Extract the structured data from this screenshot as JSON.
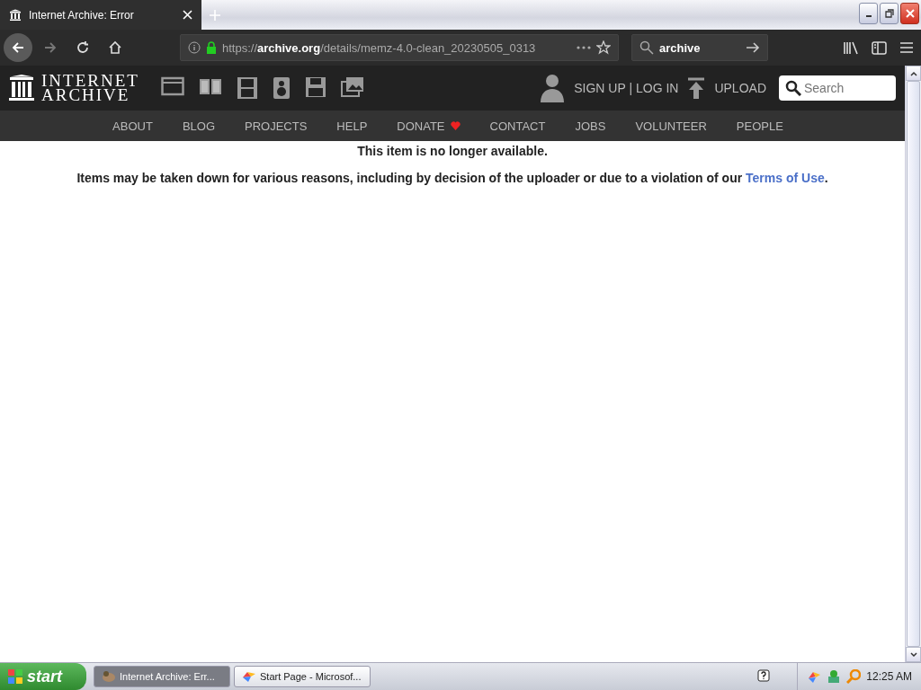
{
  "browser": {
    "tabs": [
      {
        "title": "Internet Archive: Error",
        "selected": true
      }
    ],
    "url": "https://**archive.org**/details/memz-4.0-clean_20230505_0313",
    "search": {
      "value": "archive"
    }
  },
  "site": {
    "logo": [
      "INTERNET",
      "ARCHIVE"
    ],
    "account": "SIGN UP | LOG IN",
    "upload": "UPLOAD",
    "search": {
      "placeholder": "Search"
    },
    "nav": [
      {
        "label": "ABOUT"
      },
      {
        "label": "BLOG"
      },
      {
        "label": "PROJECTS"
      },
      {
        "label": "HELP"
      },
      {
        "label": "DONATE",
        "heart": true
      },
      {
        "label": "CONTACT"
      },
      {
        "label": "JOBS"
      },
      {
        "label": "VOLUNTEER"
      },
      {
        "label": "PEOPLE"
      }
    ]
  },
  "message": {
    "heading": "This item is no longer available.",
    "text": "Items may be taken down for various reasons, including by decision of the uploader or due to a violation of our",
    "link": "Terms of Use",
    "end": "."
  },
  "taskbar": {
    "start": "start",
    "items": [
      {
        "label": "Internet Archive: Err...",
        "selected": true,
        "kind": "archive"
      },
      {
        "label": "Start Page - Microsof...",
        "selected": false,
        "kind": "colorful"
      }
    ],
    "clock": "12:25 AM"
  }
}
